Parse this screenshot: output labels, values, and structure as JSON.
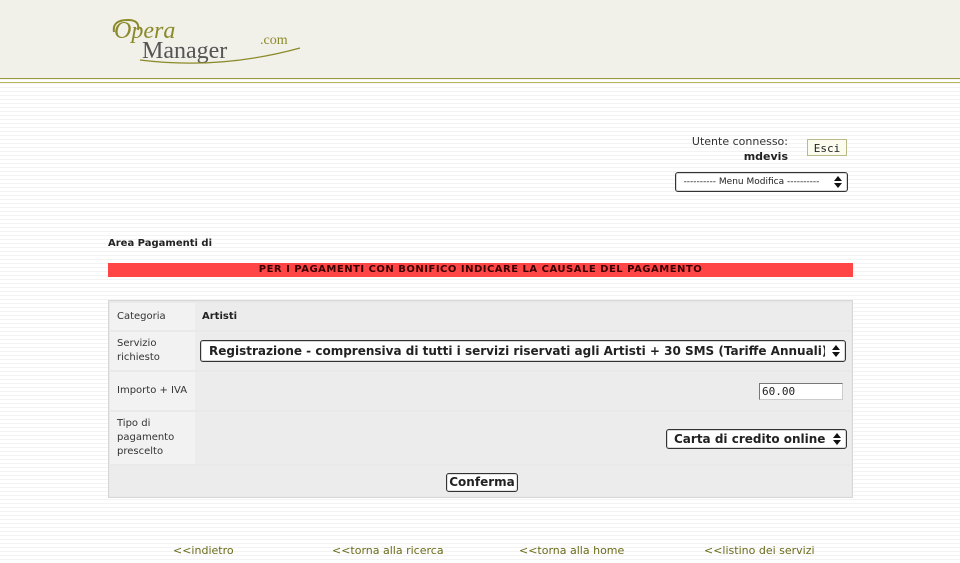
{
  "brand": {
    "logo_text_opera": "Opera",
    "logo_text_manager": "Manager",
    "logo_text_com": ".com"
  },
  "user": {
    "label": "Utente connesso:",
    "name": "mdevis",
    "logout_label": "Esci"
  },
  "menu": {
    "selected": "---------- Menu Modifica ----------"
  },
  "area_title": "Area Pagamenti di",
  "warning": "PER I PAGAMENTI CON BONIFICO INDICARE LA CAUSALE DEL PAGAMENTO",
  "form": {
    "category_label": "Categoria",
    "category_value": "Artisti",
    "service_label": "Servizio richiesto",
    "service_selected": "Registrazione - comprensiva di tutti i servizi riservati agli Artisti + 30 SMS (Tariffe Annuali)",
    "amount_label": "Importo + IVA",
    "amount_value": "60.00",
    "payment_label": "Tipo di pagamento prescelto",
    "payment_selected": "Carta di credito online",
    "confirm_label": "Conferma"
  },
  "footer": {
    "back": "<<indietro",
    "search": "<<torna alla ricerca",
    "home": "<<torna alla home",
    "services": "<<listino dei servizi"
  },
  "colors": {
    "header_bg": "#f1f0e9",
    "logo_olive": "#8a8a2a",
    "warning_red": "#ff4545",
    "link_olive": "#6b6b1a"
  }
}
